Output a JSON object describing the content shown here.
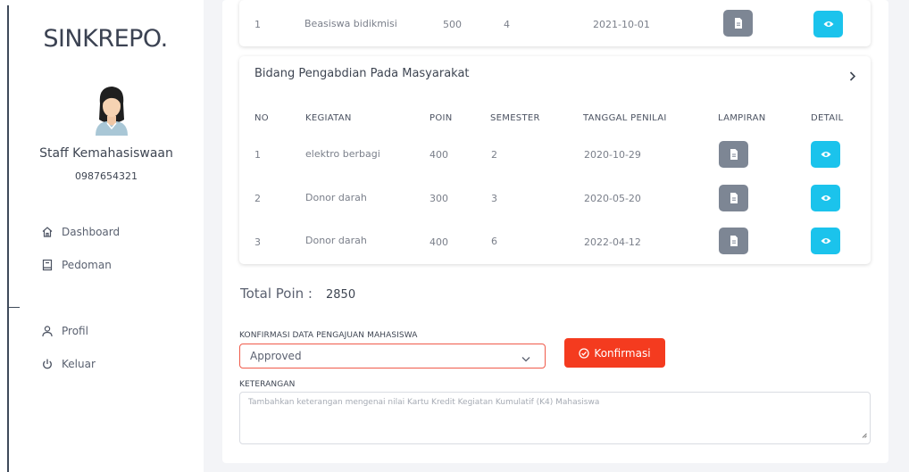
{
  "sidebar": {
    "brand": "SINKREPO.",
    "user_name": "Staff Kemahasiswaan",
    "user_phone": "0987654321",
    "nav": [
      {
        "label": "Dashboard",
        "icon": "home-icon"
      },
      {
        "label": "Pedoman",
        "icon": "book-icon"
      },
      {
        "label": "Profil",
        "icon": "user-icon"
      },
      {
        "label": "Keluar",
        "icon": "power-icon"
      }
    ]
  },
  "top_row": {
    "no": "1",
    "kegiatan": "Beasiswa bidikmisi",
    "poin": "500",
    "semester": "4",
    "tanggal": "2021-10-01"
  },
  "bidang": {
    "title": "Bidang Pengabdian Pada Masyarakat",
    "headers": {
      "no": "NO",
      "kegiatan": "KEGIATAN",
      "poin": "POIN",
      "semester": "SEMESTER",
      "tanggal": "TANGGAL PENILAI",
      "lampiran": "LAMPIRAN",
      "detail": "DETAIL"
    },
    "rows": [
      {
        "no": "1",
        "kegiatan": "elektro berbagi",
        "poin": "400",
        "semester": "2",
        "tanggal": "2020-10-29"
      },
      {
        "no": "2",
        "kegiatan": "Donor darah",
        "poin": "300",
        "semester": "3",
        "tanggal": "2020-05-20"
      },
      {
        "no": "3",
        "kegiatan": "Donor darah",
        "poin": "400",
        "semester": "6",
        "tanggal": "2022-04-12"
      }
    ]
  },
  "total": {
    "label": "Total Poin :",
    "value": "2850"
  },
  "form": {
    "konfirmasi_label": "KONFIRMASI DATA PENGAJUAN MAHASISWA",
    "select_value": "Approved",
    "confirm_button": "Konfirmasi",
    "keterangan_label": "KETERANGAN",
    "keterangan_placeholder": "Tambahkan keterangan mengenai nilai Kartu Kredit Kegiatan Kumulatif (K4) Mahasiswa"
  },
  "colors": {
    "accent_red": "#f43b1f",
    "button_cyan": "#1bc3ec",
    "button_gray": "#7d8694"
  }
}
